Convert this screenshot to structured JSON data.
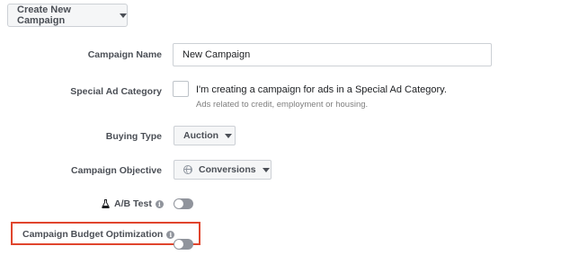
{
  "header": {
    "create_button_label": "Create New Campaign"
  },
  "form": {
    "campaign_name": {
      "label": "Campaign Name",
      "value": "New Campaign"
    },
    "special_ad_category": {
      "label": "Special Ad Category",
      "checkbox_text": "I'm creating a campaign for ads in a Special Ad Category.",
      "helper_text": "Ads related to credit, employment or housing.",
      "checked": false
    },
    "buying_type": {
      "label": "Buying Type",
      "value": "Auction"
    },
    "campaign_objective": {
      "label": "Campaign Objective",
      "value": "Conversions",
      "icon": "globe-icon"
    },
    "ab_test": {
      "label": "A/B Test",
      "icon": "flask-icon",
      "enabled": false
    },
    "campaign_budget_optimization": {
      "label": "Campaign Budget Optimization",
      "enabled": false,
      "highlighted": true
    }
  },
  "colors": {
    "highlight_border": "#e0452d",
    "toggle_off": "#90949c",
    "label_text": "#4b4f56"
  }
}
